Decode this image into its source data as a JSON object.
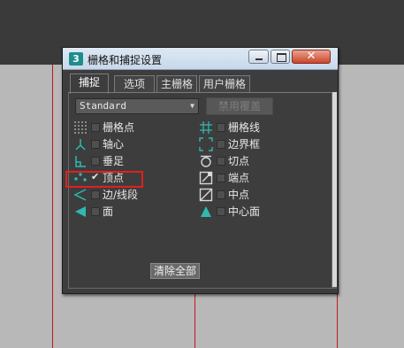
{
  "dialog": {
    "app_icon": "3",
    "title": "栅格和捕捉设置",
    "close_glyph": "✕",
    "tabs": [
      {
        "label": "捕捉",
        "active": true
      },
      {
        "label": "选项",
        "active": false
      },
      {
        "label": "主栅格",
        "active": false
      },
      {
        "label": "用户栅格",
        "active": false
      }
    ],
    "preset_selected": "Standard",
    "dropdown_arrow": "▼",
    "override_label": "禁用覆盖",
    "clear_all_label": "清除全部"
  },
  "snaps_left": [
    {
      "label": "栅格点",
      "checked": false,
      "icon": "grid-points-icon"
    },
    {
      "label": "轴心",
      "checked": false,
      "icon": "pivot-icon"
    },
    {
      "label": "垂足",
      "checked": false,
      "icon": "perpendicular-icon"
    },
    {
      "label": "顶点",
      "checked": true,
      "icon": "vertex-icon"
    },
    {
      "label": "边/线段",
      "checked": false,
      "icon": "edge-segment-icon"
    },
    {
      "label": "面",
      "checked": false,
      "icon": "face-icon"
    }
  ],
  "snaps_right": [
    {
      "label": "栅格线",
      "checked": false,
      "icon": "grid-lines-icon"
    },
    {
      "label": "边界框",
      "checked": false,
      "icon": "bounding-box-icon"
    },
    {
      "label": "切点",
      "checked": false,
      "icon": "tangent-icon"
    },
    {
      "label": "端点",
      "checked": false,
      "icon": "endpoint-icon"
    },
    {
      "label": "中点",
      "checked": false,
      "icon": "midpoint-icon"
    },
    {
      "label": "中心面",
      "checked": false,
      "icon": "center-face-icon"
    }
  ],
  "colors": {
    "icon_teal": "#2fb8b0",
    "highlight_red": "#e02020"
  }
}
